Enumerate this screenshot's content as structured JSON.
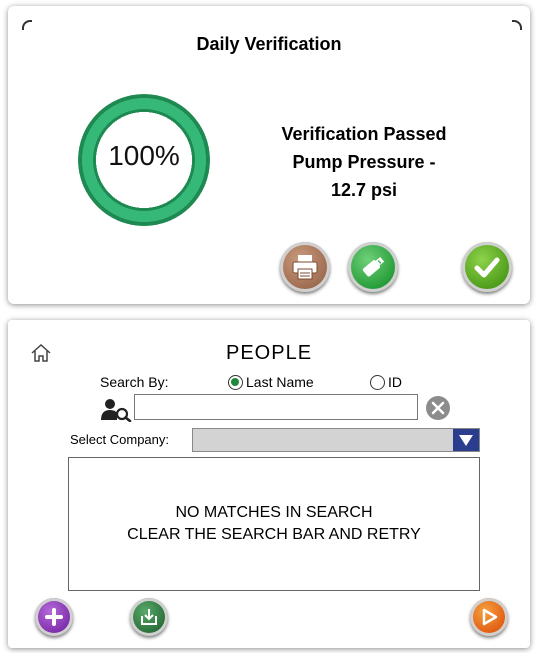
{
  "verification": {
    "title": "Daily Verification",
    "progress_text": "100%",
    "progress": 1.0,
    "status_line1": "Verification Passed",
    "status_line2": "Pump Pressure -",
    "status_line3": "12.7 psi",
    "buttons": {
      "print_icon": "printer-icon",
      "usb_icon": "usb-icon",
      "confirm_icon": "checkmark-icon"
    },
    "colors": {
      "ring": "#35b878",
      "ring_edge": "#1e8a52"
    }
  },
  "people": {
    "title": "PEOPLE",
    "home_icon": "home-icon",
    "search_by_label": "Search By:",
    "radio_last_name": "Last Name",
    "radio_id": "ID",
    "selected_radio": "Last Name",
    "search_value": "",
    "select_company_label": "Select Company:",
    "select_company_value": "",
    "results_line1": "NO MATCHES IN SEARCH",
    "results_line2": "CLEAR THE SEARCH BAR AND RETRY",
    "buttons": {
      "add_icon": "plus-icon",
      "import_icon": "download-icon",
      "next_icon": "play-icon"
    },
    "colors": {
      "select_arrow": "#2b3d8f",
      "radio_selected": "#1e8a3a"
    }
  }
}
